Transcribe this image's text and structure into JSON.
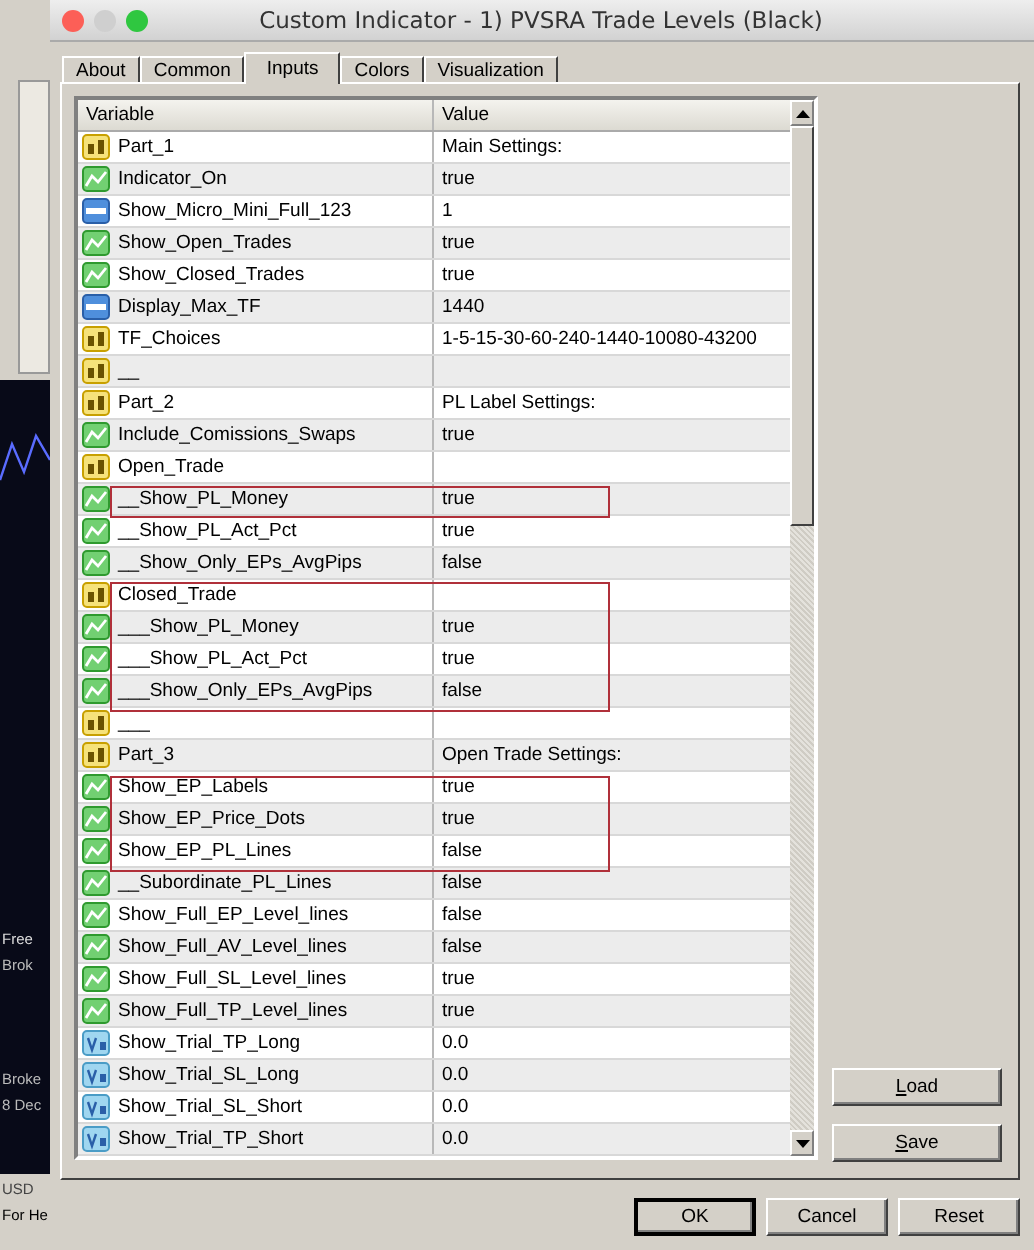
{
  "backdrop": {
    "chart_labels": [
      "Free",
      "Brok",
      "Broke",
      "8 Dec"
    ],
    "status_texts": [
      "USD",
      "For He"
    ]
  },
  "window": {
    "title": "Custom Indicator - 1) PVSRA Trade Levels (Black)"
  },
  "tabs": [
    {
      "label": "About",
      "selected": false
    },
    {
      "label": "Common",
      "selected": false
    },
    {
      "label": "Inputs",
      "selected": true
    },
    {
      "label": "Colors",
      "selected": false
    },
    {
      "label": "Visualization",
      "selected": false
    }
  ],
  "table": {
    "columns": [
      "Variable",
      "Value"
    ],
    "rows": [
      {
        "name": "Part_1",
        "value": "Main Settings:",
        "kind": "string",
        "outlined": false
      },
      {
        "name": "Indicator_On",
        "value": "true",
        "kind": "bool",
        "outlined": false
      },
      {
        "name": "Show_Micro_Mini_Full_123",
        "value": "1",
        "kind": "int",
        "outlined": false
      },
      {
        "name": "Show_Open_Trades",
        "value": "true",
        "kind": "bool",
        "outlined": false
      },
      {
        "name": "Show_Closed_Trades",
        "value": "true",
        "kind": "bool",
        "outlined": false
      },
      {
        "name": "Display_Max_TF",
        "value": "1440",
        "kind": "int",
        "outlined": false
      },
      {
        "name": "TF_Choices",
        "value": "1-5-15-30-60-240-1440-10080-43200",
        "kind": "string",
        "outlined": false
      },
      {
        "name": "__",
        "value": "",
        "kind": "string",
        "outlined": false
      },
      {
        "name": "Part_2",
        "value": "PL Label Settings:",
        "kind": "string",
        "outlined": false
      },
      {
        "name": "Include_Comissions_Swaps",
        "value": "true",
        "kind": "bool",
        "outlined": false
      },
      {
        "name": "Open_Trade",
        "value": "",
        "kind": "string",
        "outlined": false
      },
      {
        "name": "__Show_PL_Money",
        "value": "true",
        "kind": "bool",
        "outlined": true
      },
      {
        "name": "__Show_PL_Act_Pct",
        "value": "true",
        "kind": "bool",
        "outlined": false
      },
      {
        "name": "__Show_Only_EPs_AvgPips",
        "value": "false",
        "kind": "bool",
        "outlined": false
      },
      {
        "name": "Closed_Trade",
        "value": "",
        "kind": "string",
        "outlined": true
      },
      {
        "name": "___Show_PL_Money",
        "value": "true",
        "kind": "bool",
        "outlined": true
      },
      {
        "name": "___Show_PL_Act_Pct",
        "value": "true",
        "kind": "bool",
        "outlined": true
      },
      {
        "name": "___Show_Only_EPs_AvgPips",
        "value": "false",
        "kind": "bool",
        "outlined": true
      },
      {
        "name": "___",
        "value": "",
        "kind": "string",
        "outlined": false
      },
      {
        "name": "Part_3",
        "value": "Open Trade Settings:",
        "kind": "string",
        "outlined": false
      },
      {
        "name": "Show_EP_Labels",
        "value": "true",
        "kind": "bool",
        "outlined": true
      },
      {
        "name": "Show_EP_Price_Dots",
        "value": "true",
        "kind": "bool",
        "outlined": true
      },
      {
        "name": "Show_EP_PL_Lines",
        "value": "false",
        "kind": "bool",
        "outlined": true
      },
      {
        "name": "__Subordinate_PL_Lines",
        "value": "false",
        "kind": "bool",
        "outlined": false
      },
      {
        "name": "Show_Full_EP_Level_lines",
        "value": "false",
        "kind": "bool",
        "outlined": false
      },
      {
        "name": "Show_Full_AV_Level_lines",
        "value": "false",
        "kind": "bool",
        "outlined": false
      },
      {
        "name": "Show_Full_SL_Level_lines",
        "value": "true",
        "kind": "bool",
        "outlined": false
      },
      {
        "name": "Show_Full_TP_Level_lines",
        "value": "true",
        "kind": "bool",
        "outlined": false
      },
      {
        "name": "Show_Trial_TP_Long",
        "value": "0.0",
        "kind": "double",
        "outlined": false
      },
      {
        "name": "Show_Trial_SL_Long",
        "value": "0.0",
        "kind": "double",
        "outlined": false
      },
      {
        "name": "Show_Trial_SL_Short",
        "value": "0.0",
        "kind": "double",
        "outlined": false
      },
      {
        "name": "Show_Trial_TP_Short",
        "value": "0.0",
        "kind": "double",
        "outlined": false
      }
    ]
  },
  "side_buttons": [
    "Load",
    "Save"
  ],
  "buttons": [
    "OK",
    "Cancel",
    "Reset"
  ]
}
